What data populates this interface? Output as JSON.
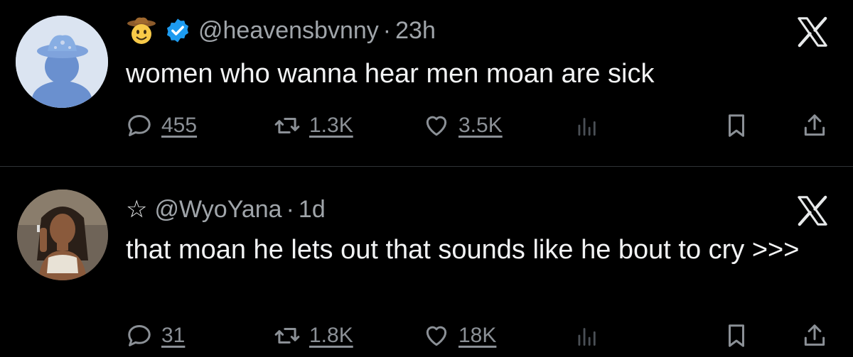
{
  "tweets": [
    {
      "handle": "@heavensbvnny",
      "time": "23h",
      "text": "women who wanna hear men moan are sick",
      "verified": true,
      "name_icon": "cowboy-emoji-icon",
      "stats": {
        "replies": "455",
        "retweets": "1.3K",
        "likes": "3.5K"
      }
    },
    {
      "handle": "@WyoYana",
      "time": "1d",
      "name_prefix": "☆",
      "text": "that moan he lets out that sounds like he bout to cry >>>",
      "verified": false,
      "stats": {
        "replies": "31",
        "retweets": "1.8K",
        "likes": "18K"
      }
    }
  ],
  "colors": {
    "background": "#000000",
    "text": "#e7e9ea",
    "muted": "#8b9096",
    "verified": "#1d9bf0"
  }
}
